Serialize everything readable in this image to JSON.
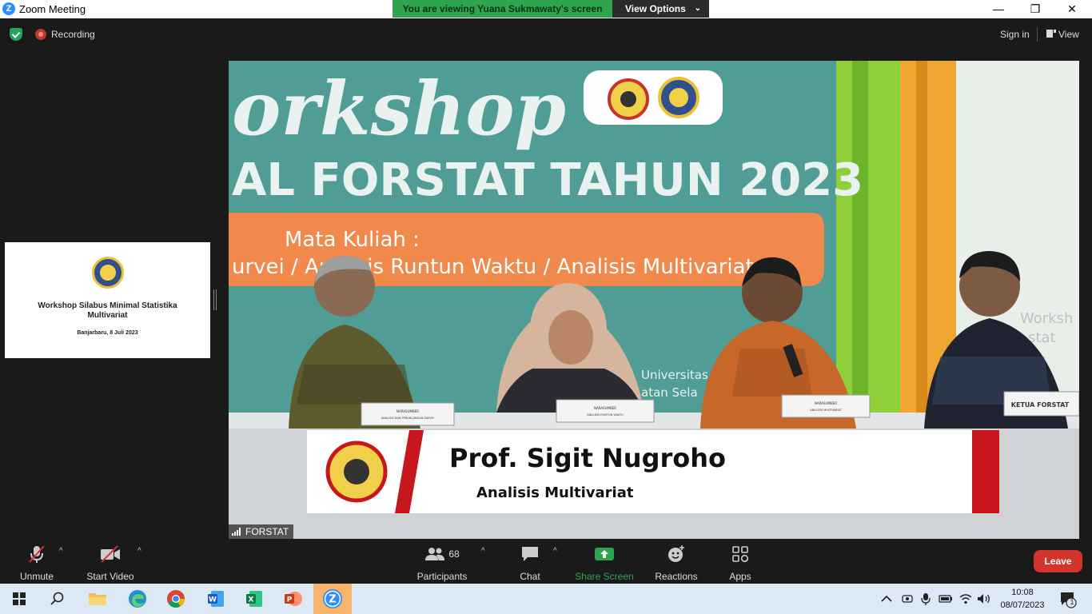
{
  "window": {
    "title": "Zoom Meeting",
    "app_icon": "Z",
    "controls": {
      "minimize": "—",
      "restore": "❐",
      "close": "✕"
    }
  },
  "banner": {
    "text": "You are viewing Yuana Sukmawaty's screen",
    "view_options": "View Options"
  },
  "topbar": {
    "recording": "Recording",
    "sign_in": "Sign in",
    "view": "View"
  },
  "thumbnail": {
    "title": "Workshop Silabus Minimal Statistika Multivariat",
    "date": "Banjarbaru, 8 Juli 2023"
  },
  "video": {
    "participant_name": "FORSTAT",
    "banner_line1": "orkshop",
    "banner_line2": "AL FORSTAT TAHUN 2023",
    "banner_subtitle": "Mata Kuliah :",
    "banner_courses": "urvei / Analisis Runtun Waktu / Analisis Multivariat",
    "university": "Universitas",
    "university2": "atan Sela",
    "right_text1": "Worksh",
    "right_text2": "stat",
    "nameplates": [
      "NARASUMBER",
      "NARASUMBER",
      "NARASUMBER",
      "KETUA FORSTAT"
    ],
    "nameplate_sub": [
      "ANALISIS DAN PERANCANGAN SURVEI",
      "ANALISIS RUNTUN WAKTU",
      "ANALISIS MULTIVARIAT"
    ],
    "lower_third": {
      "name": "Prof. Sigit Nugroho",
      "subtitle": "Analisis Multivariat"
    }
  },
  "toolbar": {
    "unmute": "Unmute",
    "start_video": "Start Video",
    "participants": "Participants",
    "participant_count": "68",
    "chat": "Chat",
    "share_screen": "Share Screen",
    "reactions": "Reactions",
    "apps": "Apps",
    "leave": "Leave"
  },
  "taskbar": {
    "time": "10:08",
    "date": "08/07/2023",
    "notification_count": "1"
  },
  "colors": {
    "zoom_blue": "#2d8cff",
    "share_green": "#2ea44f",
    "leave_red": "#d4342e",
    "mute_red": "#e02e2e"
  }
}
